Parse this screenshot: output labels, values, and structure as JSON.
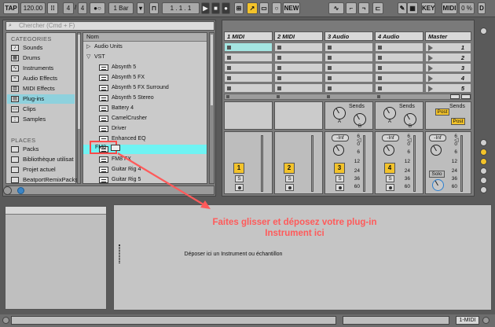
{
  "transport": {
    "tap": "TAP",
    "tempo": "120.00",
    "sig_num": "4",
    "sig_den": "4",
    "quant": "1 Bar",
    "position": "1 .   1 .   1",
    "new": "NEW",
    "key": "KEY",
    "midi": "MIDI",
    "cpu": "0 %",
    "d_label": "D"
  },
  "browser": {
    "search_placeholder": "Chercher (Cmd + F)",
    "categories_header": "CATEGORIES",
    "categories": [
      {
        "label": "Sounds",
        "icon": "note-icon"
      },
      {
        "label": "Drums",
        "icon": "drum-icon"
      },
      {
        "label": "Instruments",
        "icon": "wave-icon"
      },
      {
        "label": "Audio Effects",
        "icon": "audio-fx-icon"
      },
      {
        "label": "MIDI Effects",
        "icon": "midi-fx-icon"
      },
      {
        "label": "Plug-ins",
        "icon": "plugin-icon"
      },
      {
        "label": "Clips",
        "icon": "clip-icon"
      },
      {
        "label": "Samples",
        "icon": "sample-icon"
      }
    ],
    "places_header": "PLACES",
    "places": [
      {
        "label": "Packs"
      },
      {
        "label": "Bibliothèque utilisat"
      },
      {
        "label": "Projet actuel"
      },
      {
        "label": "BeatportRemixPacks"
      }
    ],
    "column_header": "Nom",
    "items": [
      {
        "label": "Audio Units",
        "folder": true,
        "open": false
      },
      {
        "label": "VST",
        "folder": true,
        "open": true
      },
      {
        "label": "Absynth 5"
      },
      {
        "label": "Absynth 5 FX"
      },
      {
        "label": "Absynth 5 FX Surround"
      },
      {
        "label": "Absynth 5 Stereo"
      },
      {
        "label": "Battery 4"
      },
      {
        "label": "CamelCrusher"
      },
      {
        "label": "Driver"
      },
      {
        "label": "Enhanced EQ"
      },
      {
        "label": "FM8"
      },
      {
        "label": "FM8 FX"
      },
      {
        "label": "Guitar Rig 4"
      },
      {
        "label": "Guitar Rig 5"
      }
    ]
  },
  "session": {
    "tracks": [
      "1 MIDI",
      "2 MIDI",
      "3 Audio",
      "4 Audio",
      "Master"
    ],
    "scenes": [
      "1",
      "2",
      "3",
      "4",
      "5"
    ],
    "sends_label": "Sends",
    "knob_a": "A",
    "knob_b": "B",
    "inf_label": "-Inf",
    "post_label": "Post",
    "solo_label": "Solo",
    "s_label": "S",
    "scale": [
      "6",
      "0",
      "6",
      "12",
      "24",
      "36",
      "60"
    ],
    "track_numbers": [
      "1",
      "2",
      "3",
      "4"
    ]
  },
  "detail": {
    "drop_hint": "Déposer ici un Instrument ou échantillon",
    "overlay_line1": "Faites glisser et déposez votre plug-in",
    "overlay_line2": "Instrument ici"
  },
  "status": {
    "track": "1-MIDI"
  },
  "colors": {
    "accent_yellow": "#f3c32a",
    "selection_cyan": "#6ff3f3",
    "clip_cyan": "#a4e5e1",
    "annotation_red": "#ff5a5a"
  }
}
